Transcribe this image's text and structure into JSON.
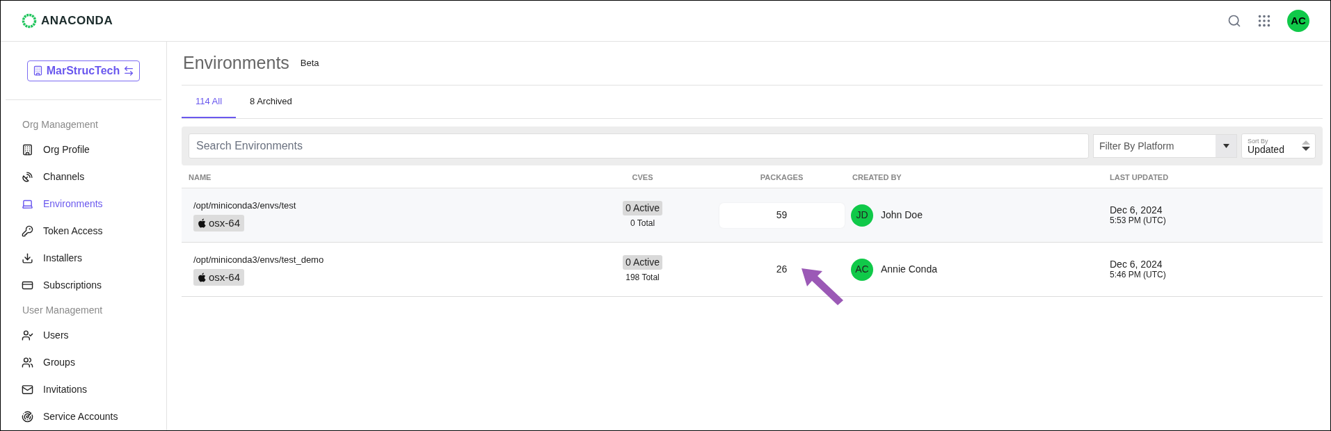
{
  "header": {
    "logo": "ANACONDA",
    "avatar": "AC"
  },
  "sidebar": {
    "org_button": "MarStrucTech",
    "sections": [
      {
        "title": "Org Management",
        "items": [
          {
            "label": "Org Profile",
            "selected": false
          },
          {
            "label": "Channels",
            "selected": false
          },
          {
            "label": "Environments",
            "selected": true
          },
          {
            "label": "Token Access",
            "selected": false
          },
          {
            "label": "Installers",
            "selected": false
          },
          {
            "label": "Subscriptions",
            "selected": false
          }
        ]
      },
      {
        "title": "User Management",
        "items": [
          {
            "label": "Users",
            "selected": false
          },
          {
            "label": "Groups",
            "selected": false
          },
          {
            "label": "Invitations",
            "selected": false
          },
          {
            "label": "Service Accounts",
            "selected": false
          }
        ]
      }
    ]
  },
  "page": {
    "title": "Environments",
    "badge": "Beta"
  },
  "tabs": [
    {
      "label": "114 All",
      "selected": true
    },
    {
      "label": "8 Archived",
      "selected": false
    }
  ],
  "toolbar": {
    "search_placeholder": "Search Environments",
    "filter_placeholder": "Filter By Platform",
    "sort_label": "Sort By",
    "sort_value": "Updated"
  },
  "table": {
    "columns": [
      "NAME",
      "CVES",
      "PACKAGES",
      "CREATED BY",
      "LAST UPDATED"
    ],
    "rows": [
      {
        "name": "/opt/miniconda3/envs/test",
        "platform": "osx-64",
        "cves_active": "0 Active",
        "cves_total": "0 Total",
        "packages": "59",
        "creator_initials": "JD",
        "creator": "John Doe",
        "date": "Dec 6, 2024",
        "time": "5:53 PM (UTC)",
        "hovered": true
      },
      {
        "name": "/opt/miniconda3/envs/test_demo",
        "platform": "osx-64",
        "cves_active": "0 Active",
        "cves_total": "198 Total",
        "packages": "26",
        "creator_initials": "AC",
        "creator": "Annie Conda",
        "date": "Dec 6, 2024",
        "time": "5:46 PM (UTC)",
        "hovered": false
      }
    ]
  }
}
